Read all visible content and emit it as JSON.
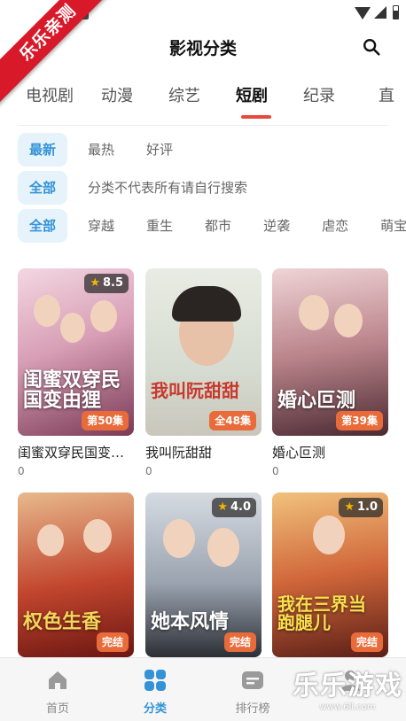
{
  "ribbon": "乐乐亲测",
  "header": {
    "title": "影视分类"
  },
  "category_tabs": [
    {
      "label": "电视剧"
    },
    {
      "label": "动漫"
    },
    {
      "label": "综艺"
    },
    {
      "label": "短剧"
    },
    {
      "label": "纪录"
    },
    {
      "label": "直"
    }
  ],
  "active_category": "短剧",
  "sort_row": [
    {
      "label": "最新"
    },
    {
      "label": "最热"
    },
    {
      "label": "好评"
    }
  ],
  "scope_row": {
    "active": "全部",
    "note": "分类不代表所有请自行搜索"
  },
  "genre_row": [
    {
      "label": "全部"
    },
    {
      "label": "穿越"
    },
    {
      "label": "重生"
    },
    {
      "label": "都市"
    },
    {
      "label": "逆袭"
    },
    {
      "label": "虐恋"
    },
    {
      "label": "萌宝"
    }
  ],
  "cards": [
    {
      "name": "闺蜜双穿民国变…",
      "count": "0",
      "rating": "8.5",
      "badge": "第50集",
      "art_title": "闺蜜双穿民国变由狸"
    },
    {
      "name": "我叫阮甜甜",
      "count": "0",
      "rating": "",
      "badge": "全48集",
      "art_title": "我叫阮甜甜"
    },
    {
      "name": "婚心叵测",
      "count": "0",
      "rating": "",
      "badge": "第39集",
      "art_title": "婚心叵测"
    },
    {
      "name": "",
      "count": "",
      "rating": "",
      "badge": "完结",
      "art_title": "权色生香"
    },
    {
      "name": "",
      "count": "",
      "rating": "4.0",
      "badge": "完结",
      "art_title": "她本风情"
    },
    {
      "name": "",
      "count": "",
      "rating": "1.0",
      "badge": "完结",
      "art_title": "我在三界当跑腿儿"
    }
  ],
  "bottom_nav": [
    {
      "label": "首页",
      "icon": "home-icon"
    },
    {
      "label": "分类",
      "icon": "grid-icon"
    },
    {
      "label": "排行榜",
      "icon": "ranking-icon"
    },
    {
      "label": "",
      "icon": "profile-icon"
    }
  ],
  "watermark": {
    "big": "乐乐游戏",
    "url": "www.6ll.com"
  },
  "colors": {
    "accent": "#3493d6",
    "tab_indicator": "#e74a3b",
    "badge": "#ea6b3a",
    "ribbon": "#d8192a"
  }
}
